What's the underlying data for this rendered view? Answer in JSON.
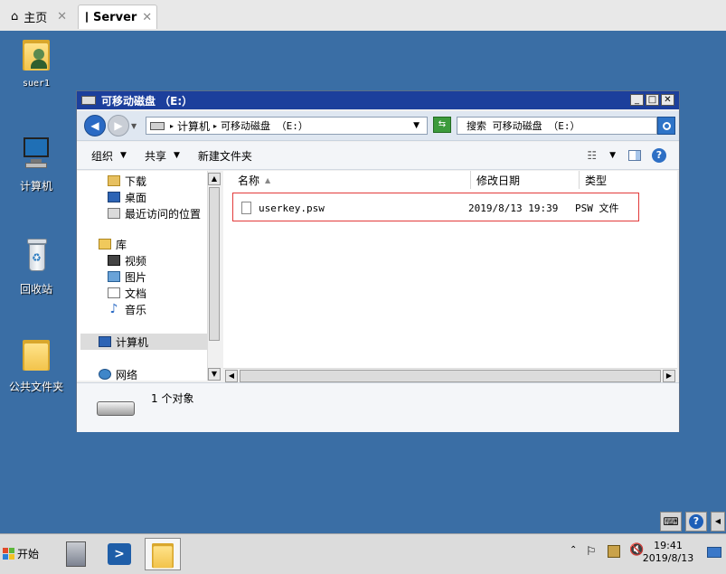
{
  "tabs": [
    {
      "label": "主页",
      "icon": "home-icon"
    },
    {
      "label": "Server",
      "icon": "server-vm-icon"
    }
  ],
  "desktop_icons": [
    {
      "label": "suer1",
      "icon": "user-folder-icon"
    },
    {
      "label": "计算机",
      "icon": "computer-icon"
    },
    {
      "label": "回收站",
      "icon": "recycle-bin-icon"
    },
    {
      "label": "公共文件夹",
      "icon": "folder-icon"
    }
  ],
  "window": {
    "title": "可移动磁盘 （E:）",
    "address": {
      "computer": "计算机",
      "location": "可移动磁盘 （E:）"
    },
    "search_placeholder": "搜索 可移动磁盘 （E:）",
    "toolbar": {
      "organize": "组织",
      "share": "共享",
      "new_folder": "新建文件夹"
    },
    "nav": {
      "downloads": "下载",
      "desktop": "桌面",
      "recent": "最近访问的位置",
      "libraries": "库",
      "videos": "视频",
      "pictures": "图片",
      "documents": "文档",
      "music": "音乐",
      "computer": "计算机",
      "network": "网络"
    },
    "columns": {
      "name": "名称",
      "modified": "修改日期",
      "type": "类型"
    },
    "files": [
      {
        "name": "userkey.psw",
        "modified": "2019/8/13 19:39",
        "type": "PSW 文件"
      }
    ],
    "status": "1 个对象"
  },
  "taskbar": {
    "start_label": "开始",
    "time": "19:41",
    "date": "2019/8/13"
  },
  "colors": {
    "desktop": "#3a6ea5",
    "titlebar": "#1c3f9c",
    "highlight": "#e23a3a"
  }
}
